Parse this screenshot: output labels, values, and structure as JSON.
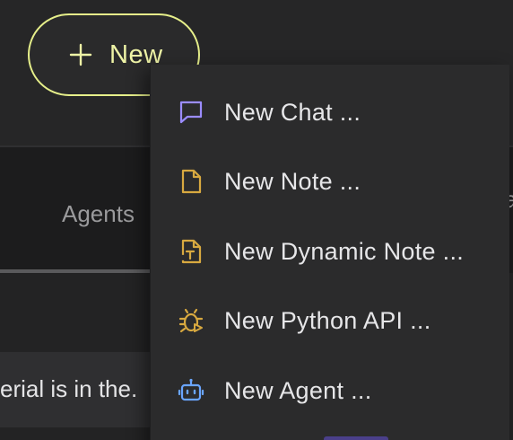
{
  "header": {
    "new_button_label": "New"
  },
  "tabs": {
    "agents_label": "Agents",
    "partial_label": "a"
  },
  "content": {
    "message_snippet": "erial is in the."
  },
  "new_menu": {
    "items": [
      {
        "label": "New Chat ...",
        "icon": "chat-bubble-icon",
        "color": "#9b8cff"
      },
      {
        "label": "New Note ...",
        "icon": "note-icon",
        "color": "#d8a940"
      },
      {
        "label": "New Dynamic Note ...",
        "icon": "dynamic-note-icon",
        "color": "#d8a940"
      },
      {
        "label": "New Python API ...",
        "icon": "python-api-icon",
        "color": "#d8a940"
      },
      {
        "label": "New Agent ...",
        "icon": "robot-icon",
        "color": "#6aa5ff"
      }
    ]
  },
  "colors": {
    "accent": "#e6ef8a",
    "background": "#232324",
    "menu_background": "#2b2b2c"
  }
}
